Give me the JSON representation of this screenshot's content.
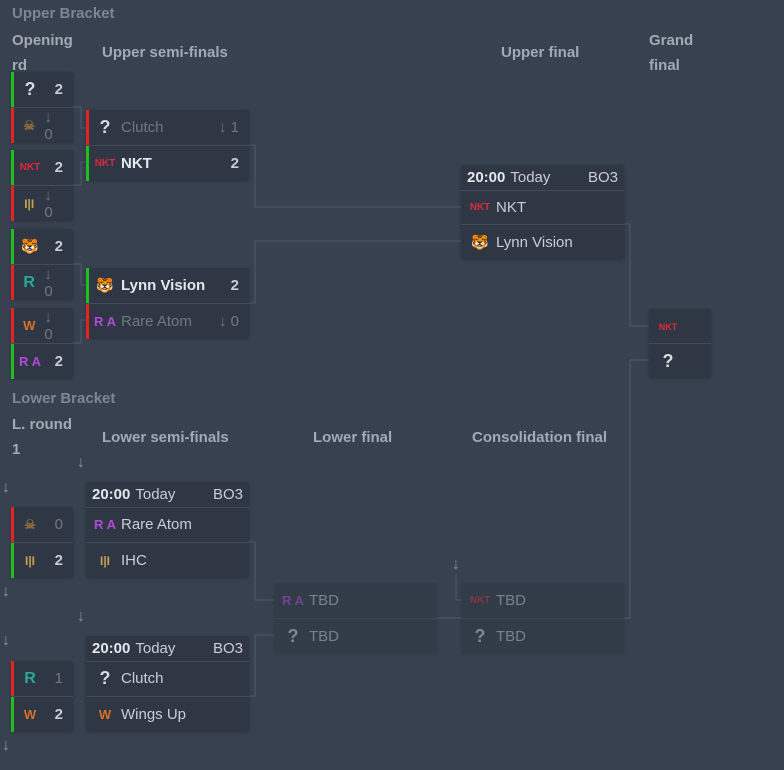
{
  "upper_bracket": {
    "title": "Upper Bracket",
    "headers": {
      "opening": "Opening rd",
      "semis": "Upper semi-finals",
      "final": "Upper final",
      "grand": "Grand final"
    },
    "opening": [
      [
        {
          "icon": "question-icon",
          "name": "",
          "score": "2",
          "win": true
        },
        {
          "icon": "mask-logo",
          "name": "",
          "score": "↓ 0",
          "win": false
        }
      ],
      [
        {
          "icon": "nkt-logo",
          "name": "",
          "score": "2",
          "win": true
        },
        {
          "icon": "ihc-logo",
          "name": "",
          "score": "↓ 0",
          "win": false
        }
      ],
      [
        {
          "icon": "lynn-vision-logo",
          "name": "",
          "score": "2",
          "win": true
        },
        {
          "icon": "r-logo",
          "name": "",
          "score": "↓ 0",
          "win": false
        }
      ],
      [
        {
          "icon": "wings-up-logo",
          "name": "",
          "score": "↓ 0",
          "win": false
        },
        {
          "icon": "rare-atom-logo",
          "name": "",
          "score": "2",
          "win": true
        }
      ]
    ],
    "semis": [
      [
        {
          "icon": "question-icon",
          "name": "Clutch",
          "score": "↓ 1",
          "win": false
        },
        {
          "icon": "nkt-logo",
          "name": "NKT",
          "score": "2",
          "win": true
        }
      ],
      [
        {
          "icon": "lynn-vision-logo",
          "name": "Lynn Vision",
          "score": "2",
          "win": true
        },
        {
          "icon": "rare-atom-logo",
          "name": "Rare Atom",
          "score": "↓ 0",
          "win": false
        }
      ]
    ],
    "final": {
      "time": "20:00",
      "day": "Today",
      "format": "BO3",
      "teams": [
        {
          "icon": "nkt-logo",
          "name": "NKT"
        },
        {
          "icon": "lynn-vision-logo",
          "name": "Lynn Vision"
        }
      ]
    },
    "grand": [
      {
        "icon": "nkt-lynn-logo"
      },
      {
        "icon": "question-icon"
      }
    ]
  },
  "lower_bracket": {
    "title": "Lower Bracket",
    "headers": {
      "round1": "L. round 1",
      "semis": "Lower semi-finals",
      "final": "Lower final",
      "consolidation": "Consolidation final"
    },
    "round1": [
      [
        {
          "icon": "mask-logo",
          "score": "0",
          "win": false
        },
        {
          "icon": "ihc-logo",
          "score": "2",
          "win": true
        }
      ],
      [
        {
          "icon": "r-logo",
          "score": "1",
          "win": false
        },
        {
          "icon": "wings-up-logo",
          "score": "2",
          "win": true
        }
      ]
    ],
    "semis": [
      {
        "time": "20:00",
        "day": "Today",
        "format": "BO3",
        "teams": [
          {
            "icon": "rare-atom-logo",
            "name": "Rare Atom"
          },
          {
            "icon": "ihc-logo",
            "name": "IHC"
          }
        ]
      },
      {
        "time": "20:00",
        "day": "Today",
        "format": "BO3",
        "teams": [
          {
            "icon": "question-icon",
            "name": "Clutch"
          },
          {
            "icon": "wings-up-logo",
            "name": "Wings Up"
          }
        ]
      }
    ],
    "final": [
      {
        "name": "TBD"
      },
      {
        "name": "TBD"
      }
    ],
    "consolidation": [
      {
        "name": "TBD"
      },
      {
        "name": "TBD"
      }
    ]
  },
  "colors": {
    "background": "#37414f",
    "card": "#2e3743",
    "win": "#1fbf1f",
    "loss": "#e52222"
  }
}
